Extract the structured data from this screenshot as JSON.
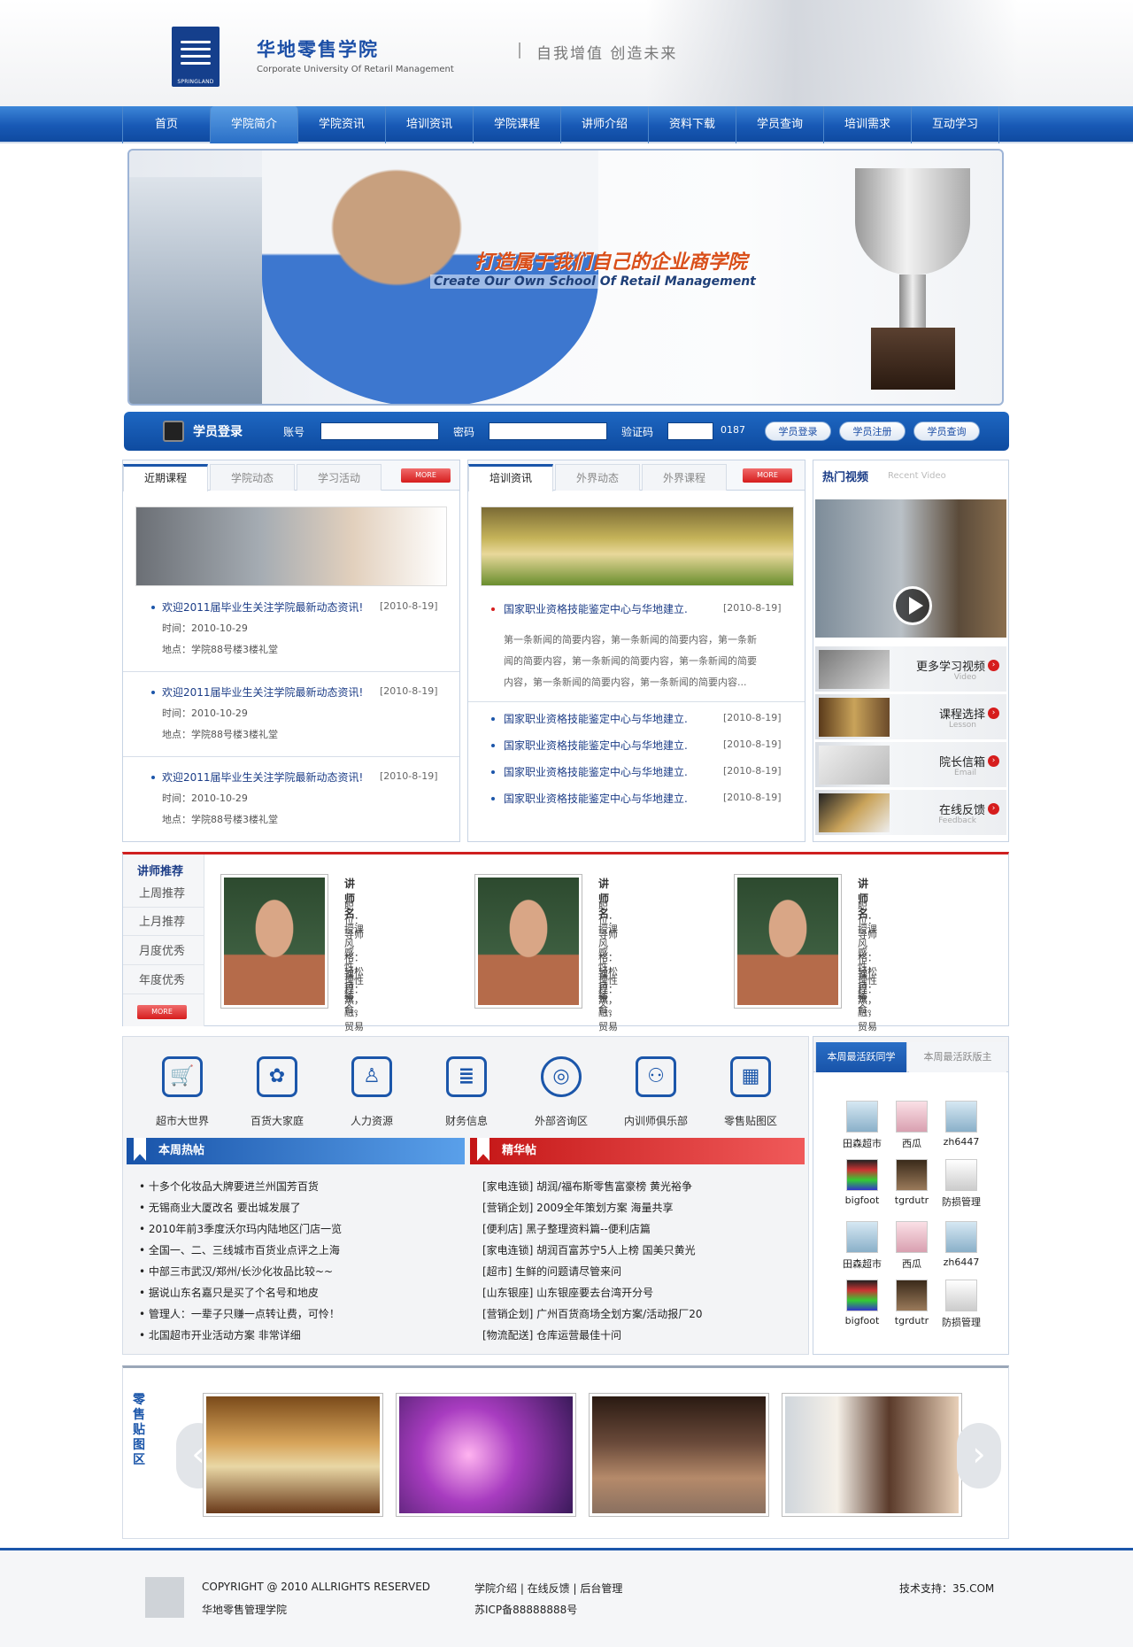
{
  "header": {
    "logo_text": "SPRINGLAND",
    "site_name": "华地零售学院",
    "site_subtitle": "Corporate University Of Retaril Management",
    "slogan": "自我增值  创造未来"
  },
  "nav": [
    "首页",
    "学院简介",
    "学院资讯",
    "培训资讯",
    "学院课程",
    "讲师介绍",
    "资料下载",
    "学员查询",
    "培训需求",
    "互动学习"
  ],
  "banner": {
    "title": "打造属于我们自己的企业商学院",
    "subtitle": "Create Our Own School Of Retail Management"
  },
  "login": {
    "title": "学员登录",
    "account_label": "账号",
    "password_label": "密码",
    "captcha_label": "验证码",
    "captcha_code": "0187",
    "btn_login": "学员登录",
    "btn_register": "学员注册",
    "btn_query": "学员查询"
  },
  "courses": {
    "tabs": [
      "近期课程",
      "学院动态",
      "学习活动"
    ],
    "more": "MORE",
    "items": [
      {
        "title": "欢迎2011届毕业生关注学院最新动态资讯!",
        "date": "[2010-8-19]",
        "time": "时间：2010-10-29",
        "place": "地点：学院88号楼3楼礼堂"
      },
      {
        "title": "欢迎2011届毕业生关注学院最新动态资讯!",
        "date": "[2010-8-19]",
        "time": "时间：2010-10-29",
        "place": "地点：学院88号楼3楼礼堂"
      },
      {
        "title": "欢迎2011届毕业生关注学院最新动态资讯!",
        "date": "[2010-8-19]",
        "time": "时间：2010-10-29",
        "place": "地点：学院88号楼3楼礼堂"
      }
    ]
  },
  "training": {
    "tabs": [
      "培训资讯",
      "外界动态",
      "外界课程"
    ],
    "more": "MORE",
    "lead_title": "国家职业资格技能鉴定中心与华地建立.",
    "lead_date": "[2010-8-19]",
    "summary": [
      "第一条新闻的简要内容，第一条新闻的简要内容，第一条新",
      "闻的简要内容，第一条新闻的简要内容，第一条新闻的简要",
      "内容，第一条新闻的简要内容，第一条新闻的简要内容..."
    ],
    "items": [
      {
        "title": "国家职业资格技能鉴定中心与华地建立.",
        "date": "[2010-8-19]"
      },
      {
        "title": "国家职业资格技能鉴定中心与华地建立.",
        "date": "[2010-8-19]"
      },
      {
        "title": "国家职业资格技能鉴定中心与华地建立.",
        "date": "[2010-8-19]"
      },
      {
        "title": "国家职业资格技能鉴定中心与华地建立.",
        "date": "[2010-8-19]"
      }
    ]
  },
  "video": {
    "title": "热门视频",
    "title_en": "Recent Video",
    "links": [
      {
        "label": "更多学习视频",
        "en": "Video"
      },
      {
        "label": "课程选择",
        "en": "Lesson"
      },
      {
        "label": "院长信箱",
        "en": "Email"
      },
      {
        "label": "在线反馈",
        "en": "Feedback"
      }
    ]
  },
  "teachers": {
    "title": "讲师推荐",
    "tabs": [
      "上周推荐",
      "上月推荐",
      "月度优秀",
      "年度优秀"
    ],
    "more": "MORE",
    "cards": [
      {
        "name": "讲师名",
        "lines": [
          "职位：导师",
          "授课风格：轻松自然，",
          "感性，理性结合。",
          "课程：",
          "金融，贸易"
        ]
      },
      {
        "name": "讲师名",
        "lines": [
          "职位：导师",
          "授课风格：轻松自然，",
          "感性，理性结合。",
          "课程：",
          "金融，贸易"
        ]
      },
      {
        "name": "讲师名",
        "lines": [
          "职位：导师",
          "授课风格：轻松自然，",
          "感性，理性结合。",
          "课程：",
          "金融，贸易"
        ]
      }
    ]
  },
  "forums": {
    "icons": [
      {
        "label": "超市大世界",
        "icon": "cart-icon",
        "glyph": "🛒"
      },
      {
        "label": "百货大家庭",
        "icon": "molecule-icon",
        "glyph": "✿"
      },
      {
        "label": "人力资源",
        "icon": "people-icon",
        "glyph": "♙"
      },
      {
        "label": "财务信息",
        "icon": "stack-icon",
        "glyph": "≣"
      },
      {
        "label": "外部咨询区",
        "icon": "globe-icon",
        "glyph": "◎"
      },
      {
        "label": "内训师俱乐部",
        "icon": "couple-icon",
        "glyph": "⚇"
      },
      {
        "label": "零售贴图区",
        "icon": "gift-icon",
        "glyph": "▦"
      }
    ],
    "hot_title": "本周热帖",
    "hot": [
      "• 十多个化妆品大牌要进兰州国芳百货",
      "• 无锡商业大厦改名  要出城发展了",
      "• 2010年前3季度沃尔玛内陆地区门店一览",
      "• 全国一、二、三线城市百货业点评之上海",
      "• 中部三市武汉/郑州/长沙化妆品比较~~",
      "• 据说山东名嘉只是买了个名号和地皮",
      "• 管理人：一辈子只赚一点转让费，可怜！",
      "• 北国超市开业活动方案  非常详细"
    ],
    "best_title": "精华帖",
    "best": [
      "[家电连锁] 胡润/福布斯零售富豪榜  黄光裕争",
      "[营销企划] 2009全年策划方案  海量共享",
      "[便利店] 黑子整理资料篇--便利店篇",
      "[家电连锁] 胡润百富苏宁5人上榜  国美只黄光",
      "[超市] 生鲜的问题请尽管来问",
      "[山东银座] 山东银座要去台湾开分号",
      "[营销企划] 广州百货商场全划方案/活动报厂20",
      "[物流配送] 仓库运营最佳十问"
    ]
  },
  "active": {
    "tabs": [
      "本周最活跃同学",
      "本周最活跃版主"
    ],
    "users": [
      "田森超市",
      "西瓜",
      "zh6447",
      "bigfoot",
      "tgrdutr",
      "防损管理",
      "田森超市",
      "西瓜",
      "zh6447",
      "bigfoot",
      "tgrdutr",
      "防损管理"
    ]
  },
  "gallery": {
    "title": "零售贴图区"
  },
  "footer": {
    "copyright": "COPYRIGHT @ 2010 ALLRIGHTS RESERVED",
    "org": "华地零售管理学院",
    "links": "学院介绍  |  在线反馈  |  后台管理",
    "icp": "苏ICP备88888888号",
    "support": "技术支持：35.COM"
  }
}
